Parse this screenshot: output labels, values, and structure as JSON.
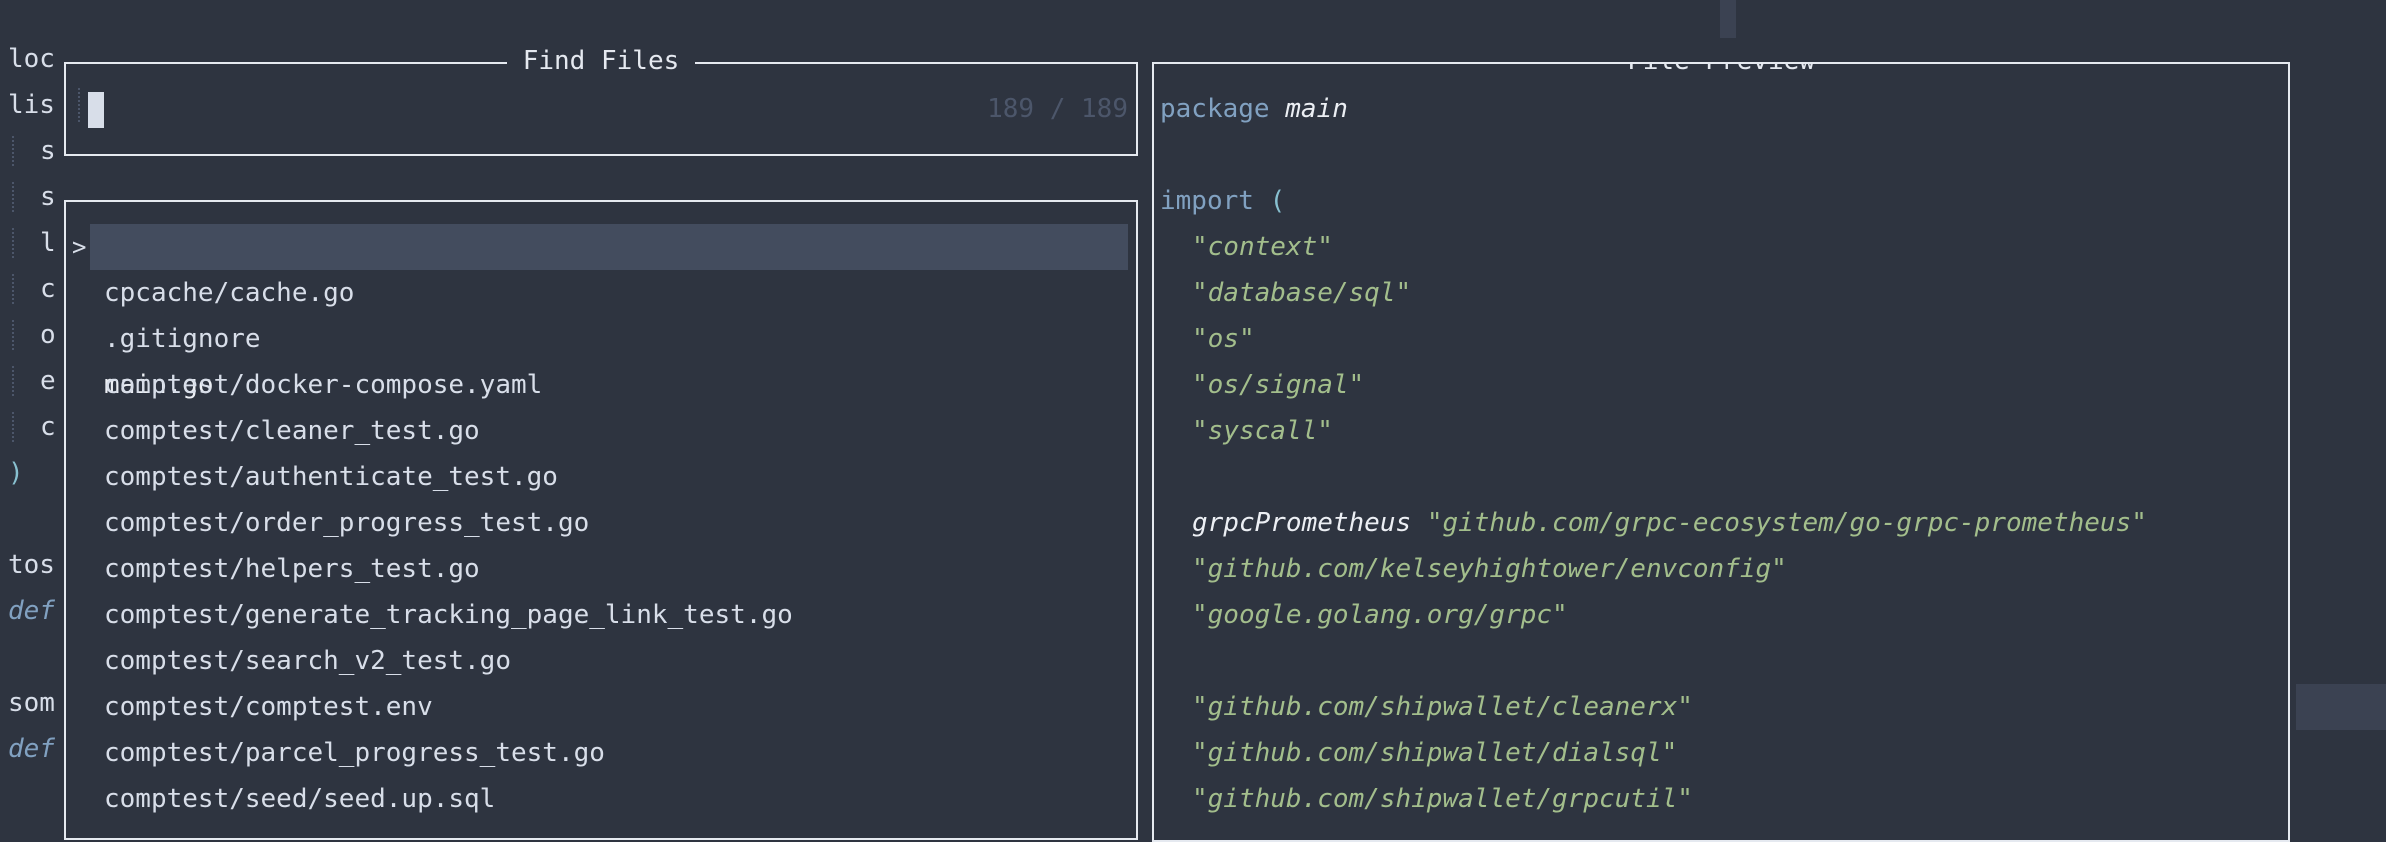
{
  "background_lines": [
    "loc",
    "lis",
    "s",
    "s",
    "l",
    "c",
    "o",
    "e",
    "c",
    ")",
    "tos",
    "def",
    "som",
    "def"
  ],
  "prompt": {
    "title": "Find Files",
    "query": "",
    "count": "189 / 189"
  },
  "results": {
    "selected_index": 0,
    "caret": ">",
    "items": [
      "main.go",
      "cpcache/cache.go",
      ".gitignore",
      "comptest/docker-compose.yaml",
      "comptest/cleaner_test.go",
      "comptest/authenticate_test.go",
      "comptest/order_progress_test.go",
      "comptest/helpers_test.go",
      "comptest/generate_tracking_page_link_test.go",
      "comptest/search_v2_test.go",
      "comptest/comptest.env",
      "comptest/parcel_progress_test.go",
      "comptest/seed/seed.up.sql"
    ]
  },
  "preview": {
    "title": "File Preview",
    "code": {
      "package_kw": "package",
      "package_name": "main",
      "import_kw": "import",
      "open_paren": "(",
      "imports": [
        "\"context\"",
        "\"database/sql\"",
        "\"os\"",
        "\"os/signal\"",
        "\"syscall\""
      ],
      "alias_name": "grpcPrometheus",
      "alias_path": "\"github.com/grpc-ecosystem/go-grpc-prometheus\"",
      "imports2": [
        "\"github.com/kelseyhightower/envconfig\"",
        "\"google.golang.org/grpc\""
      ],
      "imports3": [
        "\"github.com/shipwallet/cleanerx\"",
        "\"github.com/shipwallet/dialsql\"",
        "\"github.com/shipwallet/grpcutil\""
      ]
    }
  },
  "colors": {
    "background": "#2e3440",
    "keyword": "#81a1c1",
    "string": "#a3be8c",
    "selection": "#434c5e"
  }
}
